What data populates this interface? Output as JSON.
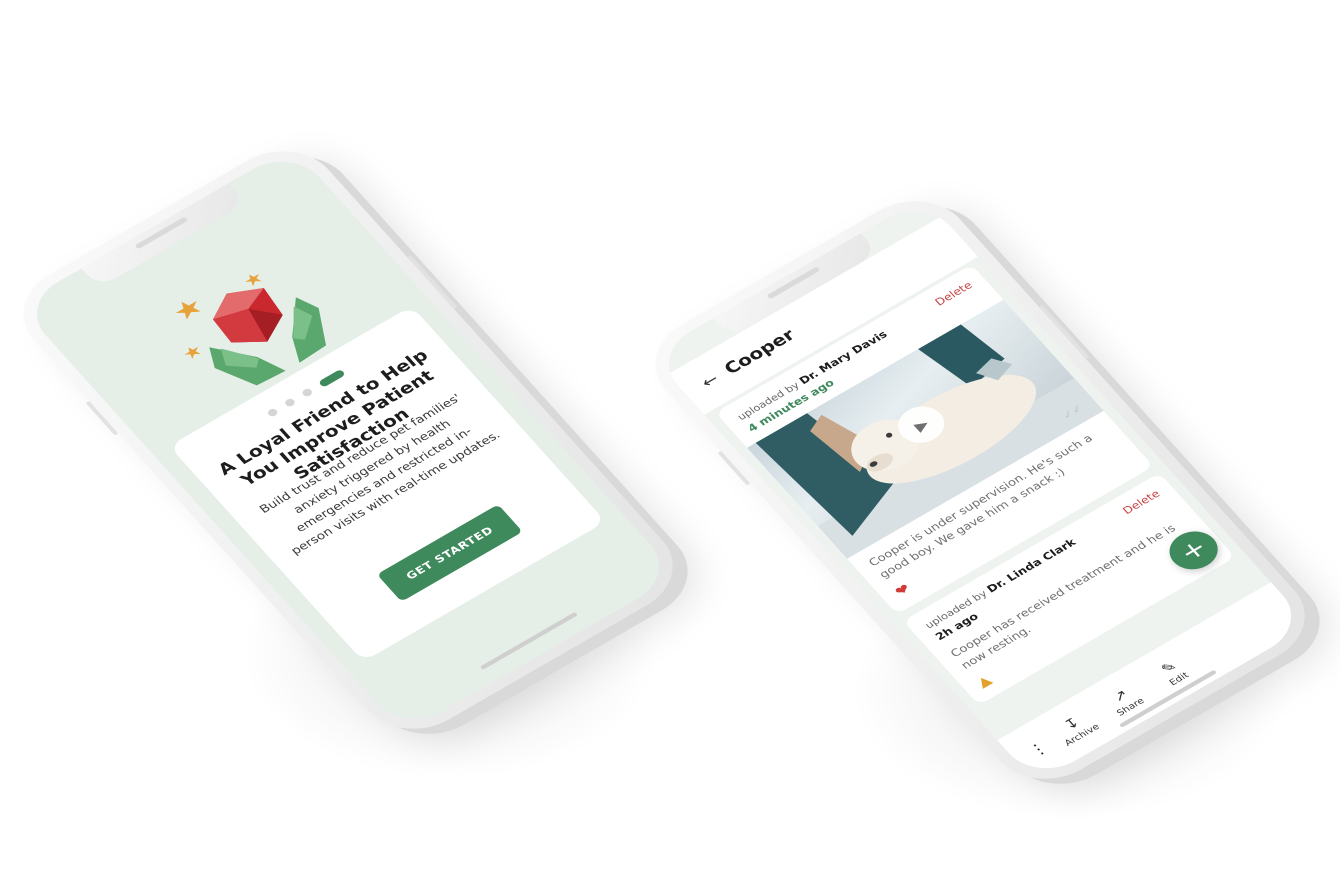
{
  "onboarding": {
    "title": "A Loyal Friend to Help You Improve Patient Satisfaction",
    "body": "Build trust and reduce pet families' anxiety triggered by health emergencies and restricted in-person visits with real-time updates.",
    "cta": "GET STARTED",
    "page_indicator": {
      "total": 4,
      "active": 4
    }
  },
  "patient_screen": {
    "title": "Cooper",
    "posts": [
      {
        "uploaded_by_label": "uploaded by",
        "author": "Dr. Mary Davis",
        "time": "4 minutes ago",
        "delete_label": "Delete",
        "text": "Cooper is under supervision. He's such a good boy. We gave him a snack :)",
        "has_video": true,
        "reaction": "heart-icon"
      },
      {
        "uploaded_by_label": "uploaded by",
        "author": "Dr. Linda Clark",
        "time": "2h ago",
        "delete_label": "Delete",
        "text": "Cooper has received treatment and he is now resting.",
        "has_video": false,
        "reaction": "thumbs-up-icon"
      }
    ],
    "fab_icon": "plus-icon",
    "bottom_toolbar": [
      {
        "label": "Archive",
        "icon": "archive-icon"
      },
      {
        "label": "Share",
        "icon": "share-icon"
      },
      {
        "label": "Edit",
        "icon": "pencil-icon"
      }
    ]
  },
  "colors": {
    "brand_green": "#3f8a5c",
    "delete_red": "#c84444",
    "heart_red": "#d33a3a",
    "screen_bg": "#e5efe8"
  }
}
